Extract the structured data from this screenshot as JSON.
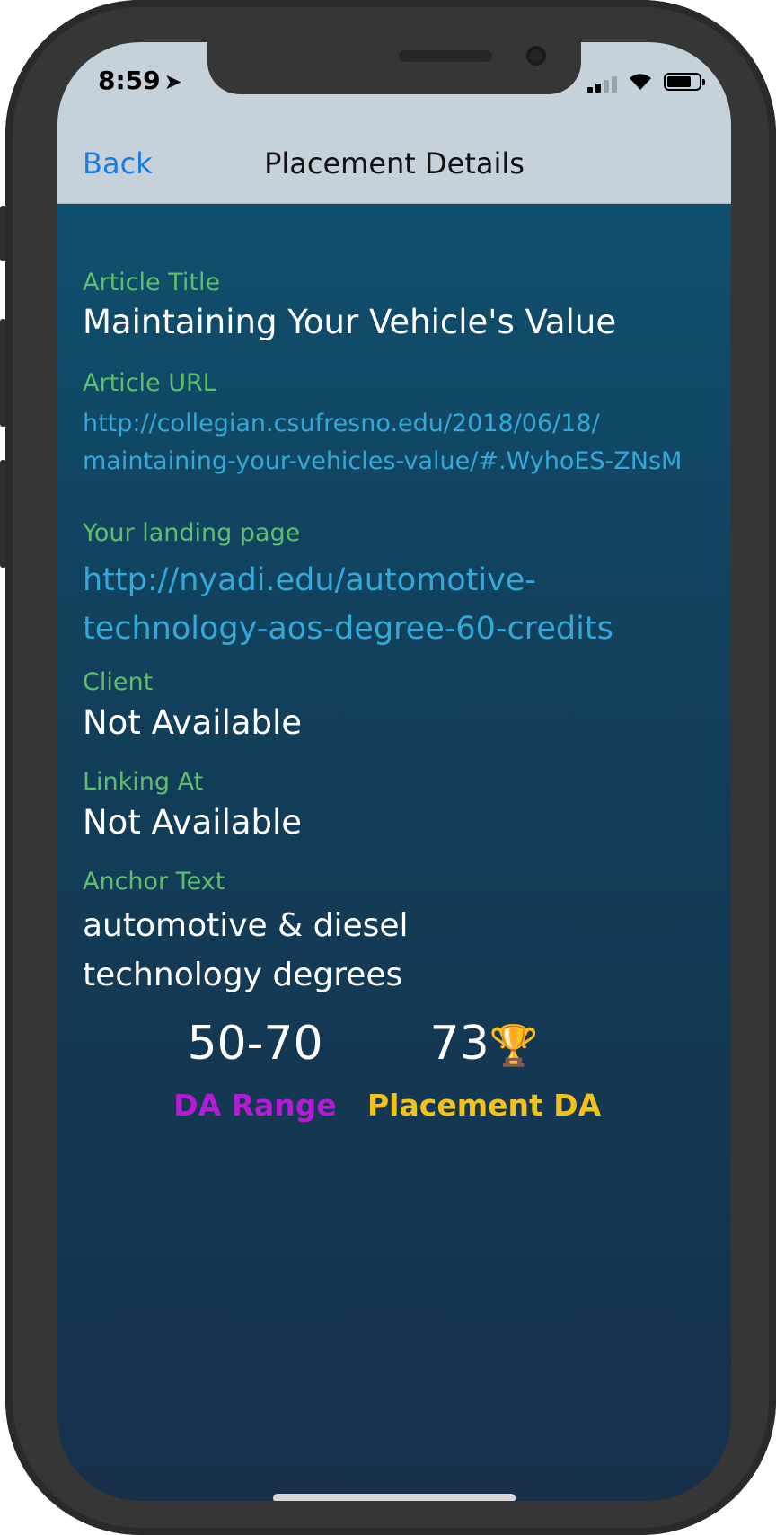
{
  "status_bar": {
    "time": "8:59",
    "location_icon": "location-arrow-icon"
  },
  "navbar": {
    "back_label": "Back",
    "title": "Placement Details"
  },
  "fields": {
    "article_title_label": "Article Title",
    "article_title_value": "Maintaining Your Vehicle's Value",
    "article_url_label": "Article URL",
    "article_url_line1": "http://collegian.csufresno.edu/2018/06/18/",
    "article_url_line2": "maintaining-your-vehicles-value/#.WyhoES-ZNsM",
    "landing_label": "Your landing page",
    "landing_line1": "http://nyadi.edu/automotive-",
    "landing_line2": "technology-aos-degree-60-credits",
    "client_label": "Client",
    "client_value": "Not Available",
    "linking_label": "Linking At",
    "linking_value": "Not Available",
    "anchor_label": "Anchor Text",
    "anchor_line1": "automotive & diesel",
    "anchor_line2": "technology degrees"
  },
  "stats": {
    "da_range_value": "50-70",
    "da_range_label": "DA Range",
    "placement_da_value": "73",
    "placement_da_icon": "🏆",
    "placement_da_label": "Placement DA"
  },
  "colors": {
    "label_green": "#5fbe6a",
    "link_blue": "#35a8d8",
    "da_range_purple": "#b51ad6",
    "placement_gold": "#f2c21a",
    "back_blue": "#1f7ae0"
  }
}
